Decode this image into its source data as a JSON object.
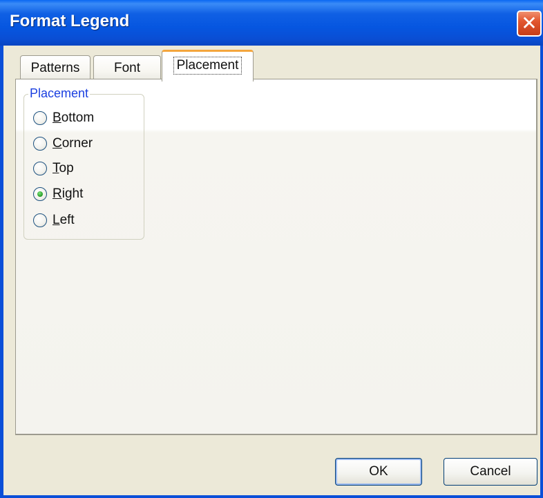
{
  "window": {
    "title": "Format Legend",
    "close_glyph": "✕"
  },
  "tabs": [
    {
      "label": "Patterns",
      "selected": false
    },
    {
      "label": "Font",
      "selected": false
    },
    {
      "label": "Placement",
      "selected": true
    }
  ],
  "placement_group": {
    "legend": "Placement",
    "options": [
      {
        "accel": "B",
        "rest": "ottom",
        "checked": false
      },
      {
        "accel": "C",
        "rest": "orner",
        "checked": false
      },
      {
        "accel": "T",
        "rest": "op",
        "checked": false
      },
      {
        "accel": "R",
        "rest": "ight",
        "checked": true
      },
      {
        "accel": "L",
        "rest": "eft",
        "checked": false
      }
    ]
  },
  "buttons": {
    "ok": "OK",
    "cancel": "Cancel"
  },
  "colors": {
    "title_bar": "#0656e0",
    "close_button": "#e2572f",
    "selected_tab_accent": "#f4a53c",
    "group_legend_text": "#1a3fe0",
    "radio_checked_dot": "#2fa42f",
    "dialog_face": "#ece9d8"
  }
}
